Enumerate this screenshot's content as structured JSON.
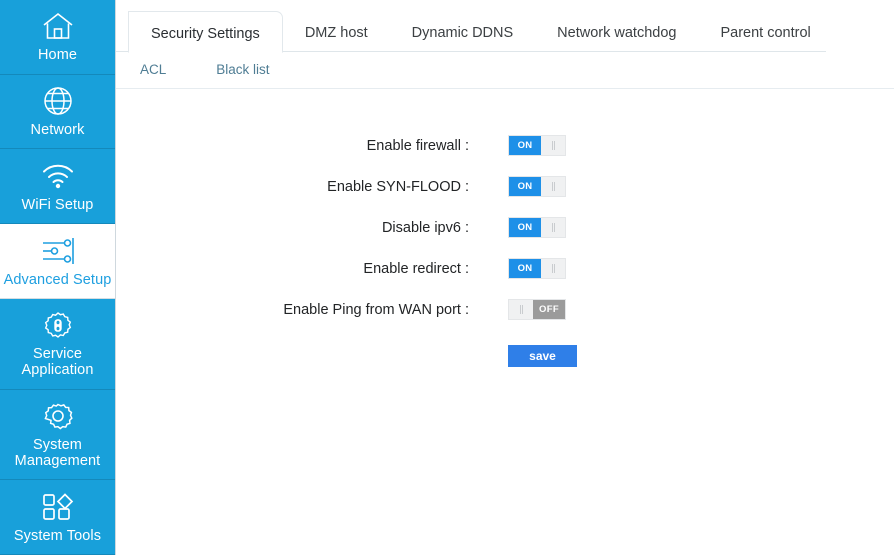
{
  "sidebar": {
    "items": [
      {
        "label": "Home",
        "icon": "home-icon",
        "active": false
      },
      {
        "label": "Network",
        "icon": "globe-icon",
        "active": false
      },
      {
        "label": "WiFi Setup",
        "icon": "wifi-icon",
        "active": false
      },
      {
        "label": "Advanced Setup",
        "icon": "sliders-icon",
        "active": true
      },
      {
        "label": "Service Application",
        "icon": "service-icon",
        "active": false
      },
      {
        "label": "System Management",
        "icon": "gear-icon",
        "active": false
      },
      {
        "label": "System Tools",
        "icon": "tools-icon",
        "active": false
      }
    ]
  },
  "tabs": [
    {
      "label": "Security Settings",
      "active": true
    },
    {
      "label": "DMZ host",
      "active": false
    },
    {
      "label": "Dynamic DDNS",
      "active": false
    },
    {
      "label": "Network watchdog",
      "active": false
    },
    {
      "label": "Parent control",
      "active": false
    }
  ],
  "subnav": [
    {
      "label": "ACL"
    },
    {
      "label": "Black list"
    }
  ],
  "form": {
    "rows": [
      {
        "label": "Enable firewall :",
        "state": "ON",
        "on_label": "ON",
        "off_label": "OFF"
      },
      {
        "label": "Enable SYN-FLOOD :",
        "state": "ON",
        "on_label": "ON",
        "off_label": "OFF"
      },
      {
        "label": "Disable ipv6 :",
        "state": "ON",
        "on_label": "ON",
        "off_label": "OFF"
      },
      {
        "label": "Enable redirect :",
        "state": "ON",
        "on_label": "ON",
        "off_label": "OFF"
      },
      {
        "label": "Enable Ping from WAN port :",
        "state": "OFF",
        "on_label": "ON",
        "off_label": "OFF"
      }
    ],
    "save_label": "save"
  },
  "colors": {
    "sidebar_bg": "#18a0da",
    "accent_blue": "#1e9fe0",
    "toggle_on": "#1e90e8",
    "toggle_off": "#9b9b9b",
    "save_button": "#2f7fe8"
  }
}
